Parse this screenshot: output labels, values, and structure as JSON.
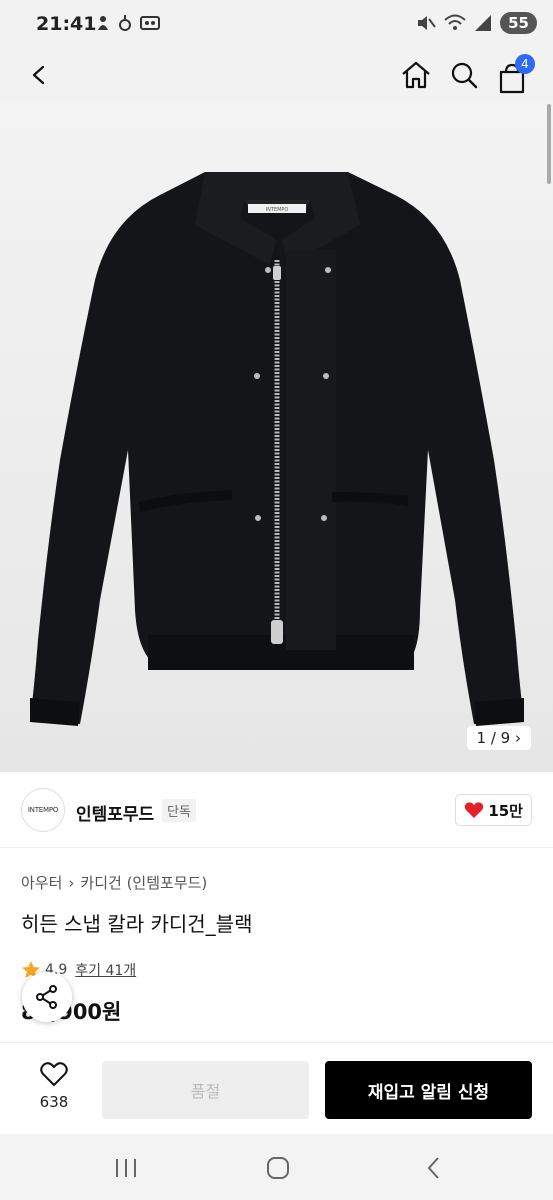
{
  "status_bar": {
    "time": "21:41",
    "battery": "55",
    "icons": [
      "notification-icon",
      "alert-icon",
      "voicemail-icon",
      "mute-icon",
      "wifi-icon",
      "signal-icon"
    ]
  },
  "header": {
    "cart_count": "4",
    "icons": [
      "back-icon",
      "home-icon",
      "search-icon",
      "cart-icon"
    ]
  },
  "gallery": {
    "counter": "1 / 9",
    "brand_label_on_garment": "INTEMPO"
  },
  "brand": {
    "logo_text": "INTEMPO",
    "name": "인템포무드",
    "tag": "단독",
    "likes": "15만"
  },
  "product": {
    "category_main": "아우터",
    "category_sub": "카디건 (인템포무드)",
    "title": "히든 스냅 칼라 카디건_블랙",
    "rating": "4.9",
    "reviews": "후기 41개",
    "price": "89,900원"
  },
  "actions": {
    "wish_count": "638",
    "soldout_label": "품절",
    "restock_label": "재입고 알림 신청"
  },
  "colors": {
    "accent_blue": "#2f6bf2",
    "heart_red": "#e2212b",
    "star_yellow": "#f5a623",
    "primary_button": "#000000"
  }
}
